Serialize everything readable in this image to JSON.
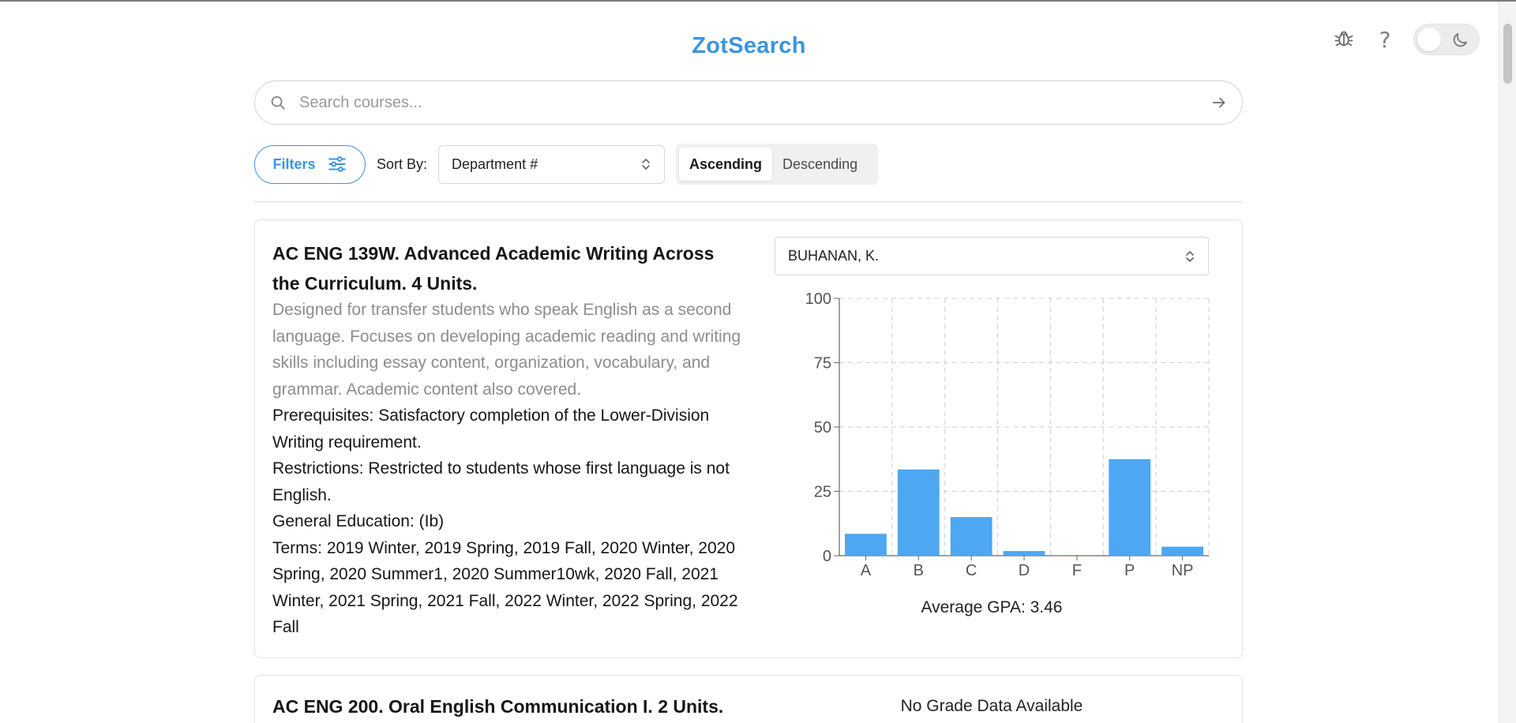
{
  "app": {
    "title": "ZotSearch"
  },
  "search": {
    "placeholder": "Search courses...",
    "value": ""
  },
  "controls": {
    "filters_label": "Filters",
    "sort_by_label": "Sort By:",
    "sort_value": "Department #",
    "order_options": [
      "Ascending",
      "Descending"
    ],
    "order_selected": "Ascending"
  },
  "icons": {
    "bug": "bug-icon",
    "help": "?",
    "theme": "moon-icon",
    "search": "search-icon",
    "submit": "arrow-right-icon",
    "filters": "sliders-icon",
    "chevrons": "chevron-up-down-icon"
  },
  "colors": {
    "accent": "#3b95e0",
    "bar": "#4da7f2"
  },
  "courses": [
    {
      "title": "AC ENG 139W. Advanced Academic Writing Across the Curriculum. 4 Units.",
      "description": "Designed for transfer students who speak English as a second language. Focuses on developing academic reading and writing skills including essay content, organization, vocabulary, and grammar. Academic content also covered.",
      "prerequisites": "Prerequisites: Satisfactory completion of the Lower-Division Writing requirement.",
      "restrictions": "Restrictions: Restricted to students whose first language is not English.",
      "ge": "General Education: (Ib)",
      "terms": "Terms: 2019 Winter, 2019 Spring, 2019 Fall, 2020 Winter, 2020 Spring, 2020 Summer1, 2020 Summer10wk, 2020 Fall, 2021 Winter, 2021 Spring, 2021 Fall, 2022 Winter, 2022 Spring, 2022 Fall",
      "instructor": "BUHANAN, K.",
      "gpa_text": "Average GPA: 3.46"
    },
    {
      "title": "AC ENG 200. Oral English Communication I. 2 Units.",
      "no_data_text": "No Grade Data Available"
    }
  ],
  "chart_data": {
    "type": "bar",
    "categories": [
      "A",
      "B",
      "C",
      "D",
      "F",
      "P",
      "NP"
    ],
    "values": [
      8.5,
      33.5,
      15,
      1.8,
      0.2,
      37.5,
      3.5
    ],
    "ylim": [
      0,
      100
    ],
    "yticks": [
      0,
      25,
      50,
      75,
      100
    ],
    "grid": true
  }
}
